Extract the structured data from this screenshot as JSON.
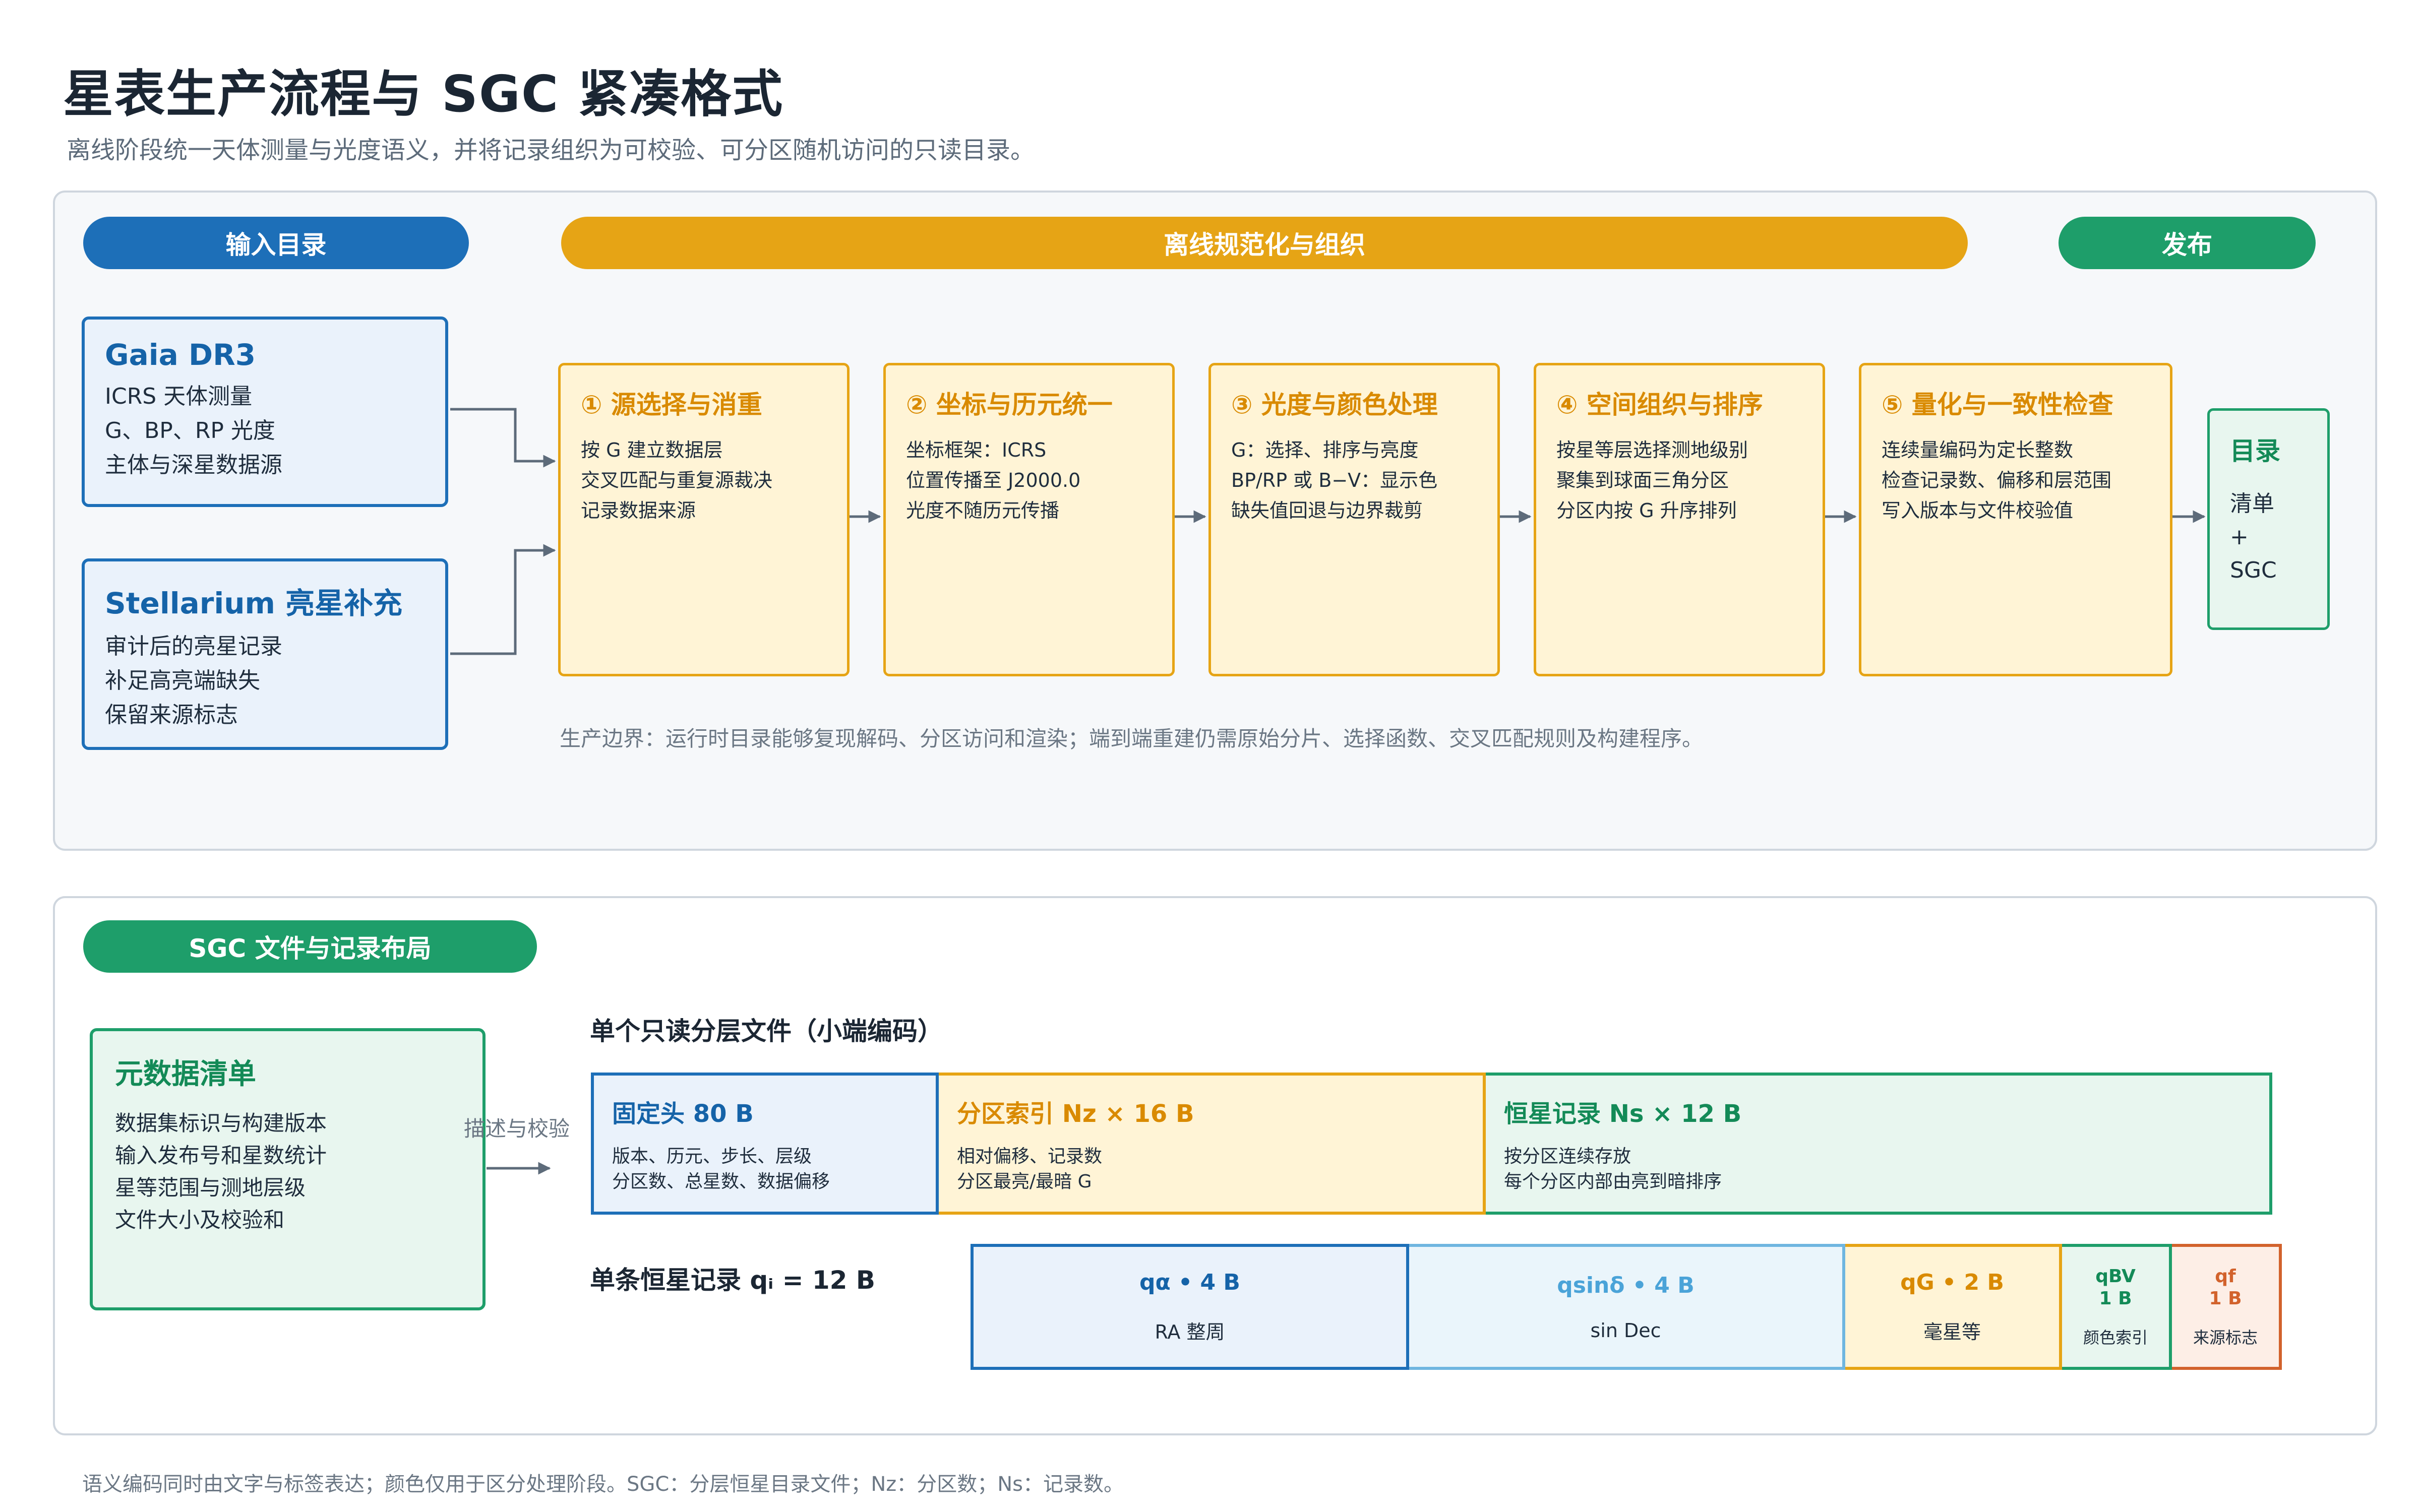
{
  "header": {
    "title": "星表生产流程与 SGC 紧凑格式",
    "subtitle": "离线阶段统一天体测量与光度语义，并将记录组织为可校验、可分区随机访问的只读目录。"
  },
  "pipeline": {
    "stages": {
      "input": "输入目录",
      "offline": "离线规范化与组织",
      "publish": "发布"
    },
    "colors": {
      "input": "#1d6fb8",
      "offline": "#e6a415",
      "publish": "#1e9e6a"
    },
    "sources": [
      {
        "title": "Gaia DR3",
        "lines": [
          "ICRS 天体测量",
          "G、BP、RP 光度",
          "主体与深星数据源"
        ]
      },
      {
        "title": "Stellarium 亮星补充",
        "lines": [
          "审计后的亮星记录",
          "补足高亮端缺失",
          "保留来源标志"
        ]
      }
    ],
    "steps": [
      {
        "title": "① 源选择与消重",
        "lines": [
          "按 G 建立数据层",
          "交叉匹配与重复源裁决",
          "记录数据来源"
        ]
      },
      {
        "title": "② 坐标与历元统一",
        "lines": [
          "坐标框架：ICRS",
          "位置传播至 J2000.0",
          "光度不随历元传播"
        ]
      },
      {
        "title": "③ 光度与颜色处理",
        "lines": [
          "G：选择、排序与亮度",
          "BP/RP 或 B−V：显示色",
          "缺失值回退与边界裁剪"
        ]
      },
      {
        "title": "④ 空间组织与排序",
        "lines": [
          "按星等层选择测地级别",
          "聚集到球面三角分区",
          "分区内按 G 升序排列"
        ]
      },
      {
        "title": "⑤ 量化与一致性检查",
        "lines": [
          "连续量编码为定长整数",
          "检查记录数、偏移和层范围",
          "写入版本与文件校验值"
        ]
      }
    ],
    "output": {
      "title": "目录",
      "lines": [
        "清单",
        "+",
        "SGC"
      ]
    },
    "boundary_note": "生产边界：运行时目录能够复现解码、分区访问和渲染；端到端重建仍需原始分片、选择函数、交叉匹配规则及构建程序。"
  },
  "layout_section": {
    "label": "SGC 文件与记录布局",
    "metadata": {
      "title": "元数据清单",
      "lines": [
        "数据集标识与构建版本",
        "输入发布号和星数统计",
        "星等范围与测地层级",
        "文件大小及校验和"
      ]
    },
    "link_label": "描述与校验",
    "file_heading": "单个只读分层文件（小端编码）",
    "segments": [
      {
        "title": "固定头  80 B",
        "lines": [
          "版本、历元、步长、层级",
          "分区数、总星数、数据偏移"
        ]
      },
      {
        "title": "分区索引  Nz × 16 B",
        "lines": [
          "相对偏移、记录数",
          "分区最亮/最暗 G"
        ]
      },
      {
        "title": "恒星记录  Ns × 12 B",
        "lines": [
          "按分区连续存放",
          "每个分区内部由亮到暗排序"
        ]
      }
    ],
    "record_heading": "单条恒星记录  qᵢ  =  12 B",
    "fields": [
      {
        "title": "qα  •  4 B",
        "desc": "RA 整周"
      },
      {
        "title": "qsinδ  •  4 B",
        "desc": "sin Dec"
      },
      {
        "title": "qG  •  2 B",
        "desc": "毫星等"
      },
      {
        "title": "qBV\n1 B",
        "desc": "颜色索引"
      },
      {
        "title": "qf\n1 B",
        "desc": "来源标志"
      }
    ]
  },
  "footnote": "语义编码同时由文字与标签表达；颜色仅用于区分处理阶段。SGC：分层恒星目录文件；Nz：分区数；Ns：记录数。"
}
